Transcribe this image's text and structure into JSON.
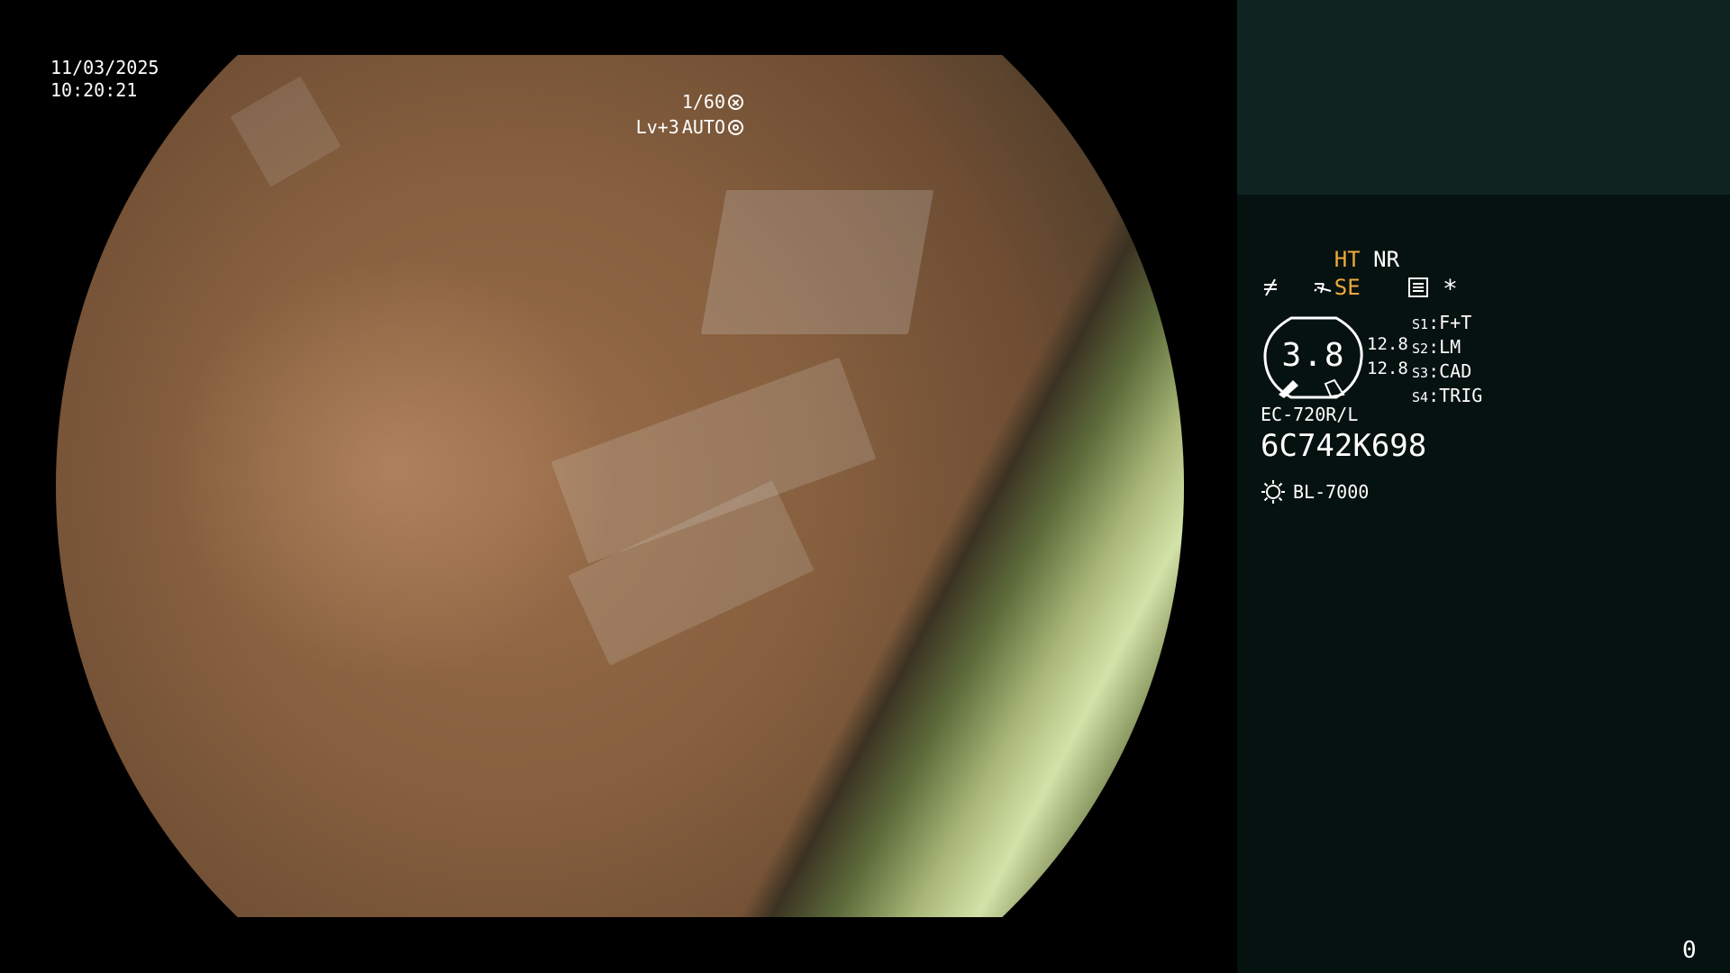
{
  "overlay": {
    "date": "11/03/2025",
    "time": "10:20:21",
    "shutter": "1/60",
    "shutter_icon": "shutter-icon",
    "exposure_level": "Lv+3",
    "iris_mode": "AUTO",
    "iris_icon": "iris-icon"
  },
  "panel": {
    "ht_label": "HT",
    "nr_label": "NR",
    "se_icon": "enhancement-icon",
    "se_label": "SE",
    "freeze_icon": "freeze-icon",
    "settings_icon": "menu-icon",
    "star": "*",
    "lens_value": "3.8",
    "lens_reading_1": "12.8",
    "lens_reading_2": "12.8",
    "switches": [
      {
        "key": "S1",
        "value": "F+T"
      },
      {
        "key": "S2",
        "value": "LM"
      },
      {
        "key": "S3",
        "value": "CAD"
      },
      {
        "key": "S4",
        "value": "TRIG"
      }
    ],
    "scope_model": "EC-720R/L",
    "scope_serial": "6C742K698",
    "light_source_icon": "light-source-icon",
    "light_source": "BL-7000",
    "counter": "0"
  },
  "colors": {
    "panel_bg": "#061210",
    "panel_top_bg": "#0f2421",
    "accent_orange": "#f0a93c"
  }
}
